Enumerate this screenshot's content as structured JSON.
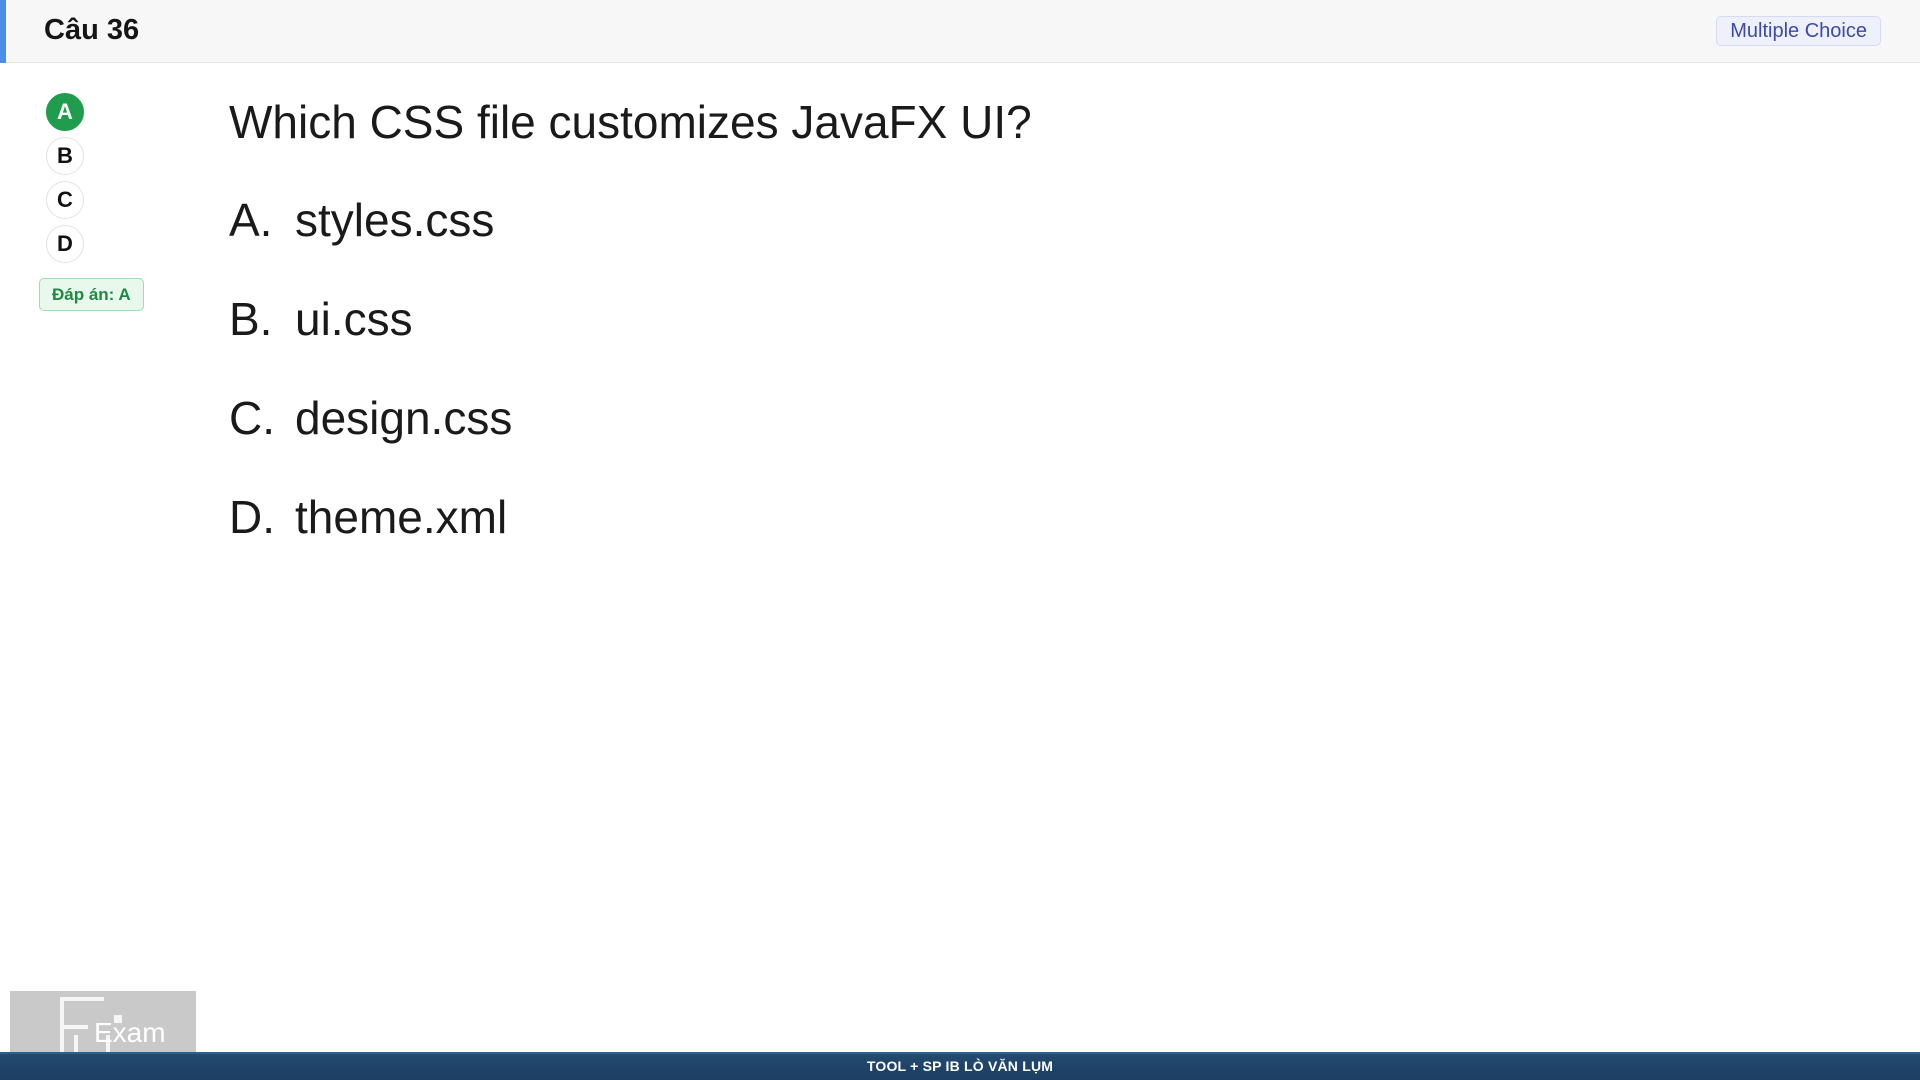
{
  "header": {
    "question_number": "Câu 36",
    "type_badge": "Multiple Choice"
  },
  "answer_selector": {
    "choices": [
      {
        "label": "A",
        "selected": true
      },
      {
        "label": "B",
        "selected": false
      },
      {
        "label": "C",
        "selected": false
      },
      {
        "label": "D",
        "selected": false
      }
    ],
    "answer_label": "Đáp án: A"
  },
  "question": {
    "text": "Which CSS file customizes JavaFX UI?",
    "options": [
      {
        "letter": "A.",
        "text": "styles.css"
      },
      {
        "letter": "B.",
        "text": "ui.css"
      },
      {
        "letter": "C.",
        "text": "design.css"
      },
      {
        "letter": "D.",
        "text": "theme.xml"
      }
    ]
  },
  "logo": {
    "text": "Exam",
    "mark": "FU"
  },
  "footer": {
    "text": "TOOL + SP IB LÒ VĂN LỤM"
  },
  "colors": {
    "header_accent": "#4a8ee8",
    "selected_choice": "#1f9d4d",
    "answer_badge_text": "#1e8a43",
    "type_badge_text": "#3d4aa6",
    "footer_bg": "#1c3e62"
  }
}
